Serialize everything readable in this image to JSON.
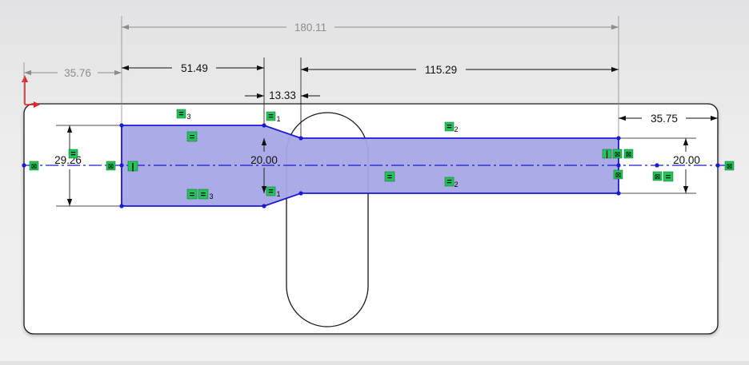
{
  "sketch": {
    "dimensions": {
      "overall_length": "180.11",
      "left_offset": "35.76",
      "shoulder_length": "51.49",
      "taper_length": "13.33",
      "neck_length": "115.29",
      "right_offset": "35.75",
      "head_height": "29.26",
      "neck_height_left": "20.00",
      "neck_height_right": "20.00"
    },
    "relations": {
      "horizontal": "=",
      "vertical": "|",
      "coincident": "⊠",
      "index_1": "1",
      "index_2": "2",
      "index_3": "3"
    },
    "colors": {
      "sketch_entity": "#1a1ad0",
      "fill": "#a6a6e6",
      "relation_badge": "#21c55a",
      "dimension": "#111111",
      "driven_dimension": "#8c8c8c",
      "origin": "#e0262c",
      "body_outline": "#1a1a1a",
      "body_fill": "#ffffff"
    }
  }
}
